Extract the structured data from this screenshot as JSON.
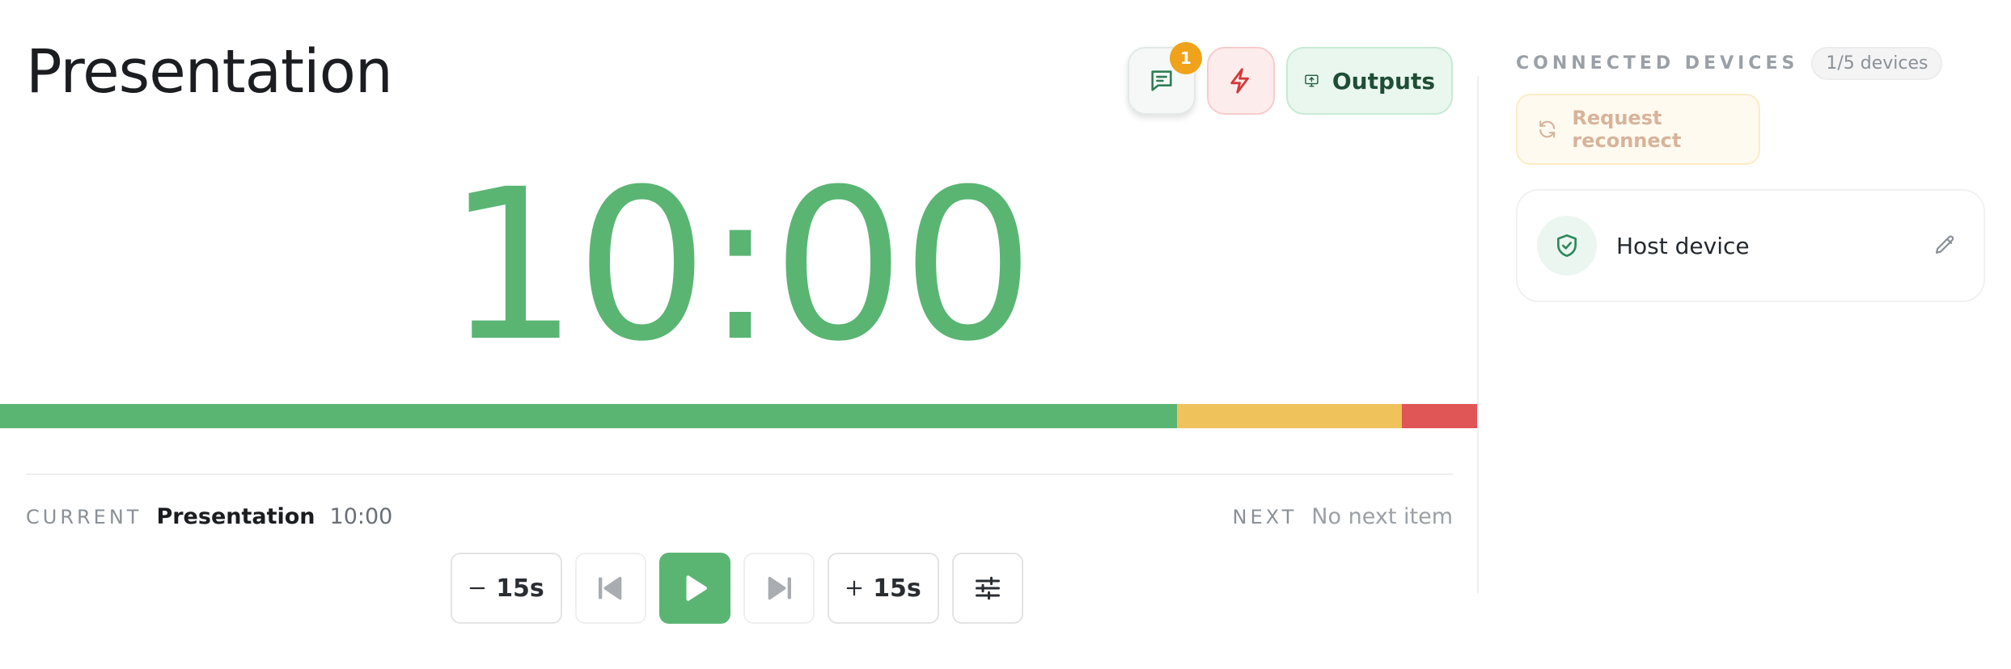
{
  "page": {
    "title": "Presentation"
  },
  "actions": {
    "messages_badge": "1",
    "outputs_label": "Outputs"
  },
  "timer": {
    "display": "10:00",
    "progress_segments": [
      {
        "color": "#5ab573",
        "fraction": 0.797
      },
      {
        "color": "#efc25c",
        "fraction": 0.152
      },
      {
        "color": "#e05555",
        "fraction": 0.051
      }
    ]
  },
  "current": {
    "caption": "CURRENT",
    "title": "Presentation",
    "time": "10:00"
  },
  "next": {
    "caption": "NEXT",
    "value": "No next item"
  },
  "controls": {
    "minus_label": "15s",
    "plus_label": "15s"
  },
  "devices": {
    "title": "CONNECTED DEVICES",
    "count": "1/5 devices",
    "reconnect_label": "Request reconnect",
    "items": [
      {
        "name": "Host device"
      }
    ]
  },
  "colors": {
    "accent_green": "#5ab573",
    "warning_yellow": "#efc25c",
    "danger_red": "#e05555",
    "badge_orange": "#f0a21a"
  }
}
